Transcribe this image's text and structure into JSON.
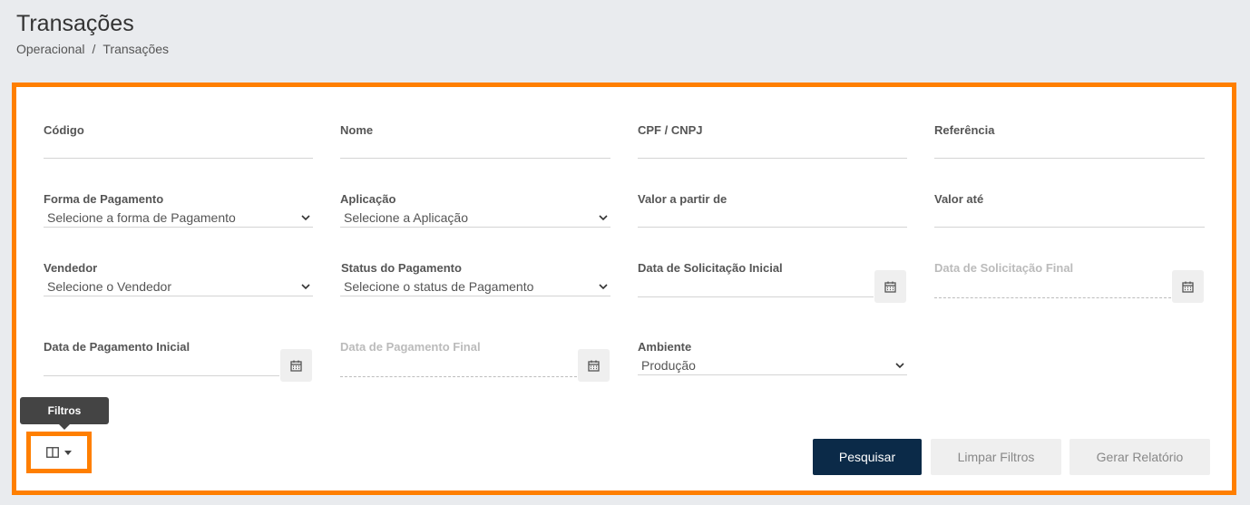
{
  "header": {
    "title": "Transações",
    "breadcrumb": [
      "Operacional",
      "/",
      "Transações"
    ]
  },
  "filters": {
    "codigo": {
      "label": "Código",
      "value": ""
    },
    "nome": {
      "label": "Nome",
      "value": ""
    },
    "cpf_cnpj": {
      "label": "CPF / CNPJ",
      "value": ""
    },
    "referencia": {
      "label": "Referência",
      "value": ""
    },
    "forma_pagamento": {
      "label": "Forma de Pagamento",
      "selected": "Selecione a forma de Pagamento"
    },
    "aplicacao": {
      "label": "Aplicação",
      "selected": "Selecione a Aplicação"
    },
    "valor_a_partir": {
      "label": "Valor a partir de",
      "value": ""
    },
    "valor_ate": {
      "label": "Valor até",
      "value": ""
    },
    "vendedor": {
      "label": "Vendedor",
      "selected": "Selecione o Vendedor"
    },
    "status_pagamento": {
      "label": "Status do Pagamento",
      "selected": "Selecione o status de Pagamento"
    },
    "data_solicitacao_inicial": {
      "label": "Data de Solicitação Inicial",
      "value": ""
    },
    "data_solicitacao_final": {
      "label": "Data de Solicitação Final",
      "value": ""
    },
    "data_pagamento_inicial": {
      "label": "Data de Pagamento Inicial",
      "value": ""
    },
    "data_pagamento_final": {
      "label": "Data de Pagamento Final",
      "value": ""
    },
    "ambiente": {
      "label": "Ambiente",
      "selected": "Produção"
    }
  },
  "actions": {
    "search_label": "Pesquisar",
    "clear_label": "Limpar Filtros",
    "report_label": "Gerar Relatório"
  },
  "tooltip": {
    "text": "Filtros"
  },
  "colors": {
    "highlight": "#ff7f00",
    "primary": "#0b2a48",
    "page_bg": "#e9ebee"
  },
  "icons": {
    "calendar": "calendar-icon",
    "chevron": "chevron-down-icon",
    "columns": "columns-icon",
    "caret": "caret-down-icon"
  }
}
